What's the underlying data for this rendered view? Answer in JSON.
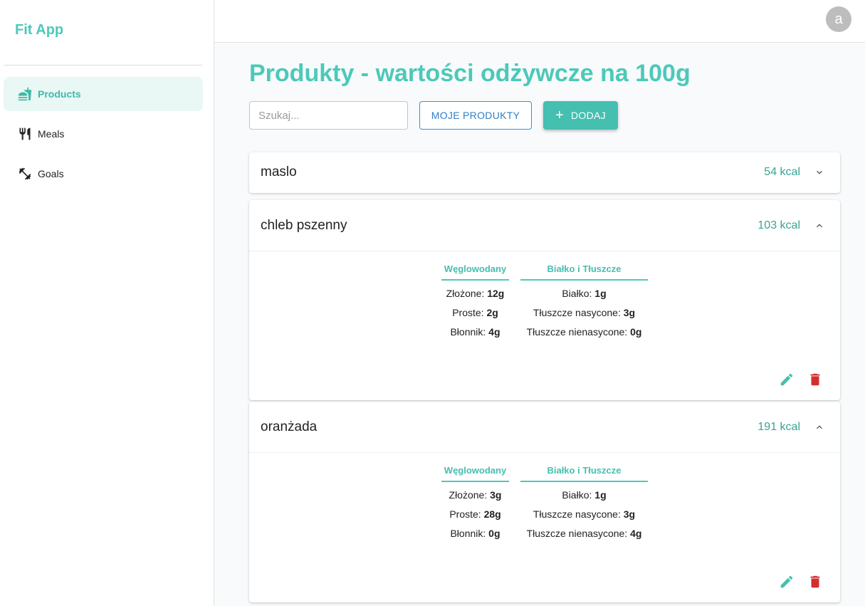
{
  "app": {
    "brand": "Fit App",
    "avatar_letter": "a"
  },
  "sidebar": {
    "items": [
      {
        "label": "Products",
        "icon": "fastfood-icon",
        "active": true
      },
      {
        "label": "Meals",
        "icon": "restaurant-icon",
        "active": false
      },
      {
        "label": "Goals",
        "icon": "fitness-icon",
        "active": false
      }
    ]
  },
  "page": {
    "title": "Produkty - wartości odżywcze na 100g",
    "search_placeholder": "Szukaj...",
    "my_products_label": "MOJE PRODUKTY",
    "add_label": "DODAJ"
  },
  "headers": {
    "carbs": "Węglowodany",
    "protein_fat": "Białko i Tłuszcze"
  },
  "labels": {
    "complex": "Złożone:",
    "simple": "Proste:",
    "fiber": "Błonnik:",
    "protein": "Białko:",
    "sat_fat": "Tłuszcze nasycone:",
    "unsat_fat": "Tłuszcze nienasycone:"
  },
  "products": [
    {
      "name": "maslo",
      "kcal": "54 kcal",
      "expanded": false
    },
    {
      "name": "chleb pszenny",
      "kcal": "103 kcal",
      "expanded": true,
      "complex": "12g",
      "simple": "2g",
      "fiber": "4g",
      "protein": "1g",
      "sat_fat": "3g",
      "unsat_fat": "0g"
    },
    {
      "name": "oranżada",
      "kcal": "191 kcal",
      "expanded": true,
      "complex": "3g",
      "simple": "28g",
      "fiber": "0g",
      "protein": "1g",
      "sat_fat": "3g",
      "unsat_fat": "4g"
    }
  ],
  "colors": {
    "accent": "#4cc9b9",
    "danger": "#d32f2f",
    "link": "#2e7fc6"
  }
}
